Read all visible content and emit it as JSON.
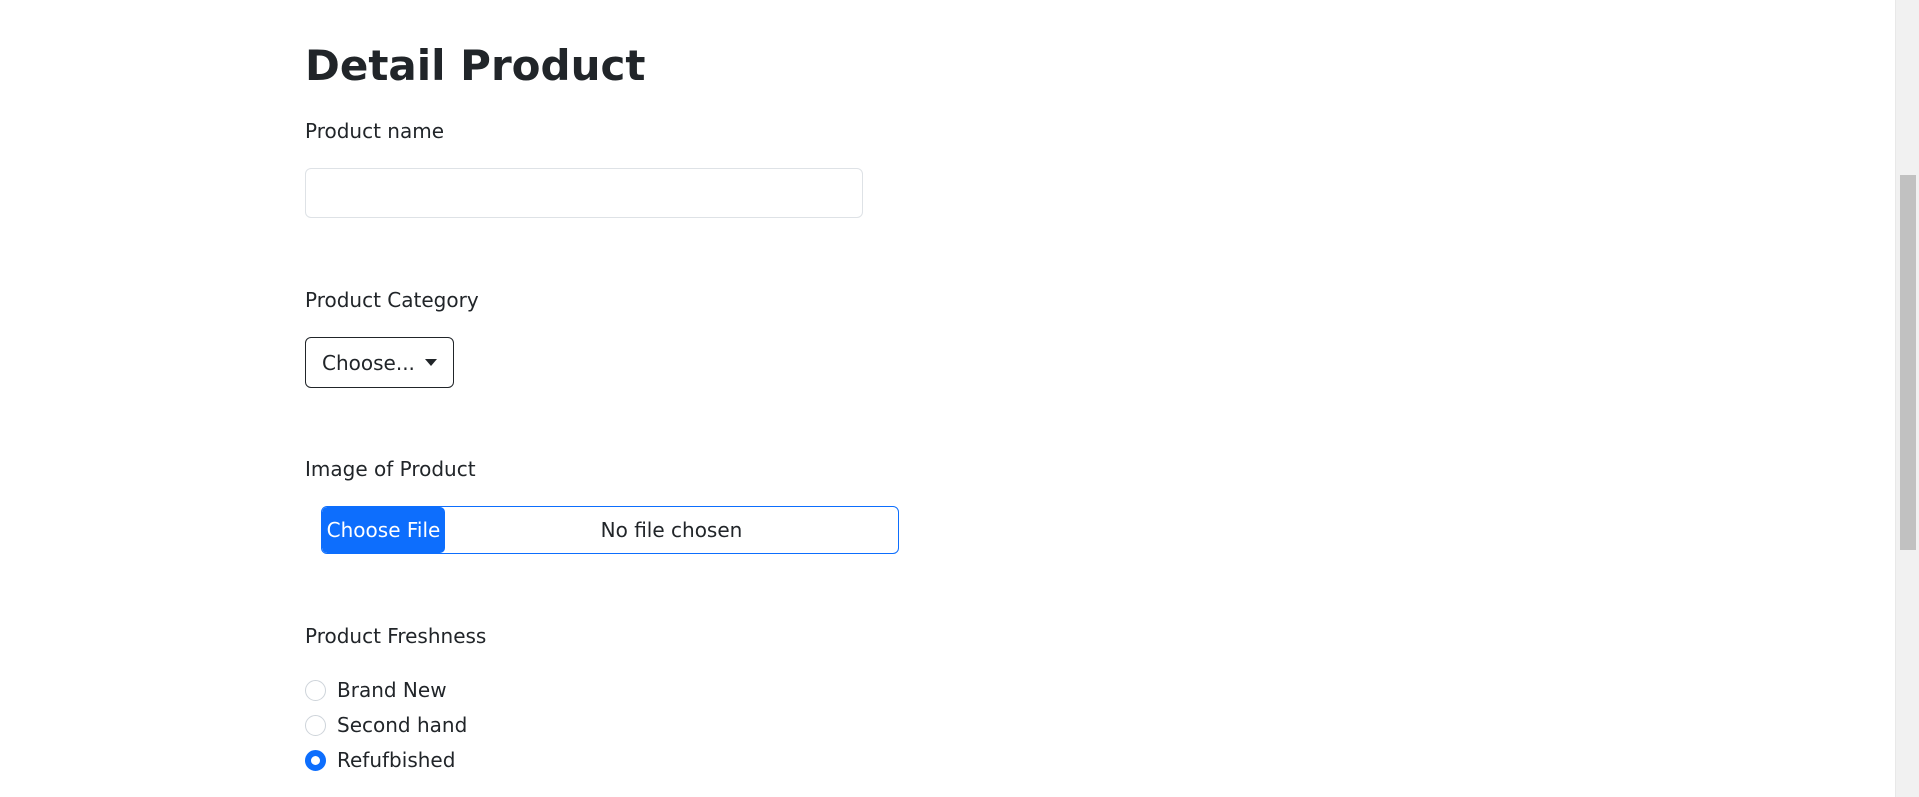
{
  "page": {
    "title": "Detail Product"
  },
  "form": {
    "product_name": {
      "label": "Product name",
      "value": "",
      "placeholder": ""
    },
    "category": {
      "label": "Product Category",
      "selected": "Choose..."
    },
    "image": {
      "label": "Image of Product",
      "button_label": "Choose File",
      "status": "No file chosen"
    },
    "freshness": {
      "label": "Product Freshness",
      "options": [
        {
          "label": "Brand New",
          "checked": false
        },
        {
          "label": "Second hand",
          "checked": false
        },
        {
          "label": "Refufbished",
          "checked": true
        }
      ]
    }
  },
  "colors": {
    "primary": "#0d6efd",
    "text": "#212529",
    "border": "#dee2e6"
  },
  "scrollbar": {
    "thumb_start_fraction": 0.22,
    "thumb_size_fraction": 0.47
  }
}
